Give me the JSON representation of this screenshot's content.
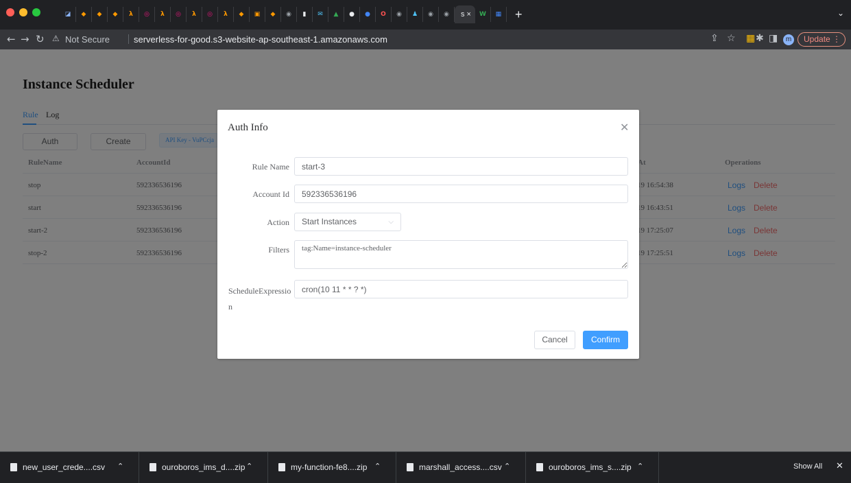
{
  "browser": {
    "tabs": [
      {
        "icon": "generic-site-icon",
        "color": "#8ab4f8"
      },
      {
        "icon": "aws-cube-icon",
        "color": "#ff9900"
      },
      {
        "icon": "aws-cube-icon",
        "color": "#ff9900"
      },
      {
        "icon": "aws-cube-icon",
        "color": "#ff9900"
      },
      {
        "icon": "aws-lambda-icon",
        "color": "#ff9900"
      },
      {
        "icon": "aws-cloudwatch-icon",
        "color": "#e7157b"
      },
      {
        "icon": "aws-lambda-icon",
        "color": "#ff9900"
      },
      {
        "icon": "aws-cloudwatch-icon",
        "color": "#e7157b"
      },
      {
        "icon": "aws-lambda-icon",
        "color": "#ff9900"
      },
      {
        "icon": "aws-cloudwatch-icon",
        "color": "#e7157b"
      },
      {
        "icon": "aws-lambda-icon",
        "color": "#ff9900"
      },
      {
        "icon": "aws-cube-icon",
        "color": "#ff9900"
      },
      {
        "icon": "aws-box-icon",
        "color": "#ff9900"
      },
      {
        "icon": "aws-cube-icon",
        "color": "#ff9900"
      },
      {
        "icon": "globe-icon",
        "color": "#9aa0a6"
      },
      {
        "icon": "doc-icon",
        "color": "#e8eaed"
      },
      {
        "icon": "chat-icon",
        "color": "#4fc3f7"
      },
      {
        "icon": "mountain-icon",
        "color": "#34a853"
      },
      {
        "icon": "github-icon",
        "color": "#e8eaed"
      },
      {
        "icon": "blue-dot-icon",
        "color": "#4285f4"
      },
      {
        "icon": "opera-icon",
        "color": "#ff5252"
      },
      {
        "icon": "globe-icon",
        "color": "#9aa0a6"
      },
      {
        "icon": "person-icon",
        "color": "#4fc3f7"
      },
      {
        "icon": "globe-icon",
        "color": "#9aa0a6"
      },
      {
        "icon": "globe-icon",
        "color": "#9aa0a6"
      },
      {
        "icon": "w-icon",
        "color": "#34a853"
      },
      {
        "icon": "grid-icon",
        "color": "#4285f4"
      }
    ],
    "active_tab_text": "s",
    "url_warning": "Not Secure",
    "url": "serverless-for-good.s3-website-ap-southeast-1.amazonaws.com",
    "profile_initial": "m",
    "update_label": "Update"
  },
  "page": {
    "title": "Instance Scheduler",
    "tabs": [
      "Rule",
      "Log"
    ],
    "buttons": {
      "auth": "Auth",
      "create": "Create"
    },
    "api_key_tag": "API Key - VuPCcja",
    "columns": {
      "rule_name": "RuleName",
      "account_id": "AccountId",
      "updated_at_fragment": "At",
      "operations": "Operations"
    },
    "rows": [
      {
        "name": "stop",
        "account": "592336536196",
        "time_fragment": "19 16:54:38"
      },
      {
        "name": "start",
        "account": "592336536196",
        "time_fragment": "19 16:43:51"
      },
      {
        "name": "start-2",
        "account": "592336536196",
        "time_fragment": "19 17:25:07"
      },
      {
        "name": "stop-2",
        "account": "592336536196",
        "time_fragment": "19 17:25:51"
      }
    ],
    "row_actions": {
      "logs": "Logs",
      "delete": "Delete"
    }
  },
  "modal": {
    "title": "Auth Info",
    "fields": {
      "rule_name": {
        "label": "Rule Name",
        "value": "start-3"
      },
      "account_id": {
        "label": "Account Id",
        "value": "592336536196"
      },
      "action": {
        "label": "Action",
        "value": "Start Instances"
      },
      "filters": {
        "label": "Filters",
        "value": "tag:Name=instance-scheduler"
      },
      "schedule": {
        "label_line1": "ScheduleExpressio",
        "label_line2": "n",
        "value": "cron(10 11 * * ? *)"
      }
    },
    "cancel_label": "Cancel",
    "confirm_label": "Confirm"
  },
  "downloads": {
    "items": [
      {
        "name": "new_user_crede....csv"
      },
      {
        "name": "ouroboros_ims_d....zip"
      },
      {
        "name": "my-function-fe8....zip"
      },
      {
        "name": "marshall_access....csv"
      },
      {
        "name": "ouroboros_ims_s....zip"
      }
    ],
    "show_all": "Show All"
  },
  "colors": {
    "accent": "#409eff",
    "danger": "#f56c6c",
    "update": "#f28b82"
  }
}
